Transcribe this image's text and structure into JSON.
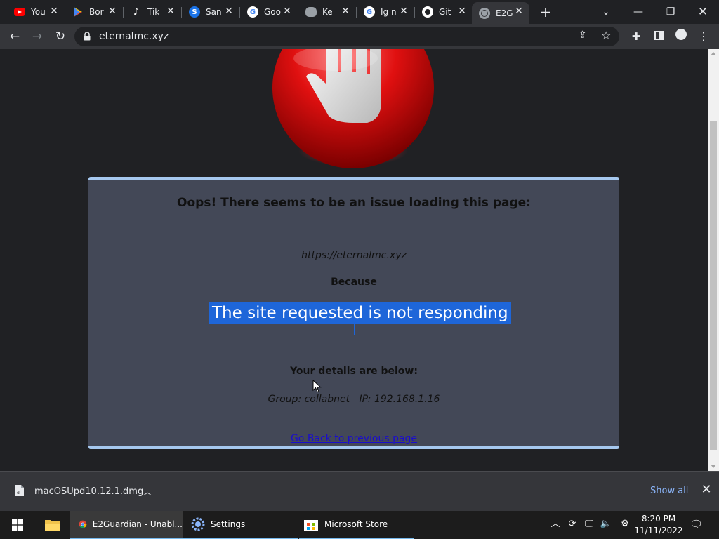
{
  "browser": {
    "tabs": [
      {
        "title": "You",
        "icon": "youtube-icon",
        "color": "#ff0000"
      },
      {
        "title": "Bor",
        "icon": "play-store-icon",
        "color": "#34a853"
      },
      {
        "title": "Tik",
        "icon": "tiktok-icon",
        "color": "#000000"
      },
      {
        "title": "San",
        "icon": "s-icon",
        "color": "#1a73e8"
      },
      {
        "title": "Goo",
        "icon": "google-icon",
        "color": "#ffffff"
      },
      {
        "title": "Ke",
        "icon": "apple-icon",
        "color": "#9aa0a6"
      },
      {
        "title": "Ig n",
        "icon": "google-icon",
        "color": "#ffffff"
      },
      {
        "title": "Git",
        "icon": "github-icon",
        "color": "#ffffff"
      },
      {
        "title": "E2G",
        "icon": "globe-icon",
        "color": "#9aa0a6",
        "active": true
      }
    ],
    "url": "eternalmc.xyz"
  },
  "page": {
    "heading": "Oops! There seems to be an issue loading this page:",
    "blocked_url": "https://eternalmc.xyz",
    "because": "Because",
    "reason": "The site requested is not responding",
    "details_heading": "Your details are below:",
    "group_ip": "Group: collabnet   IP: 192.168.1.16",
    "back_link": "Go Back to previous page",
    "accent": "#a6c8ef",
    "panel_bg": "#434857",
    "selection": "#1e66d9"
  },
  "downloads": {
    "filename": "macOSUpd10.12.1.dmg",
    "show_all": "Show all"
  },
  "taskbar": {
    "items": [
      {
        "label": "E2Guardian - Unabl...",
        "icon": "chrome-icon"
      },
      {
        "label": "Settings",
        "icon": "settings-icon"
      },
      {
        "label": "Microsoft Store",
        "icon": "store-icon"
      }
    ],
    "time": "8:20 PM",
    "date": "11/11/2022"
  }
}
